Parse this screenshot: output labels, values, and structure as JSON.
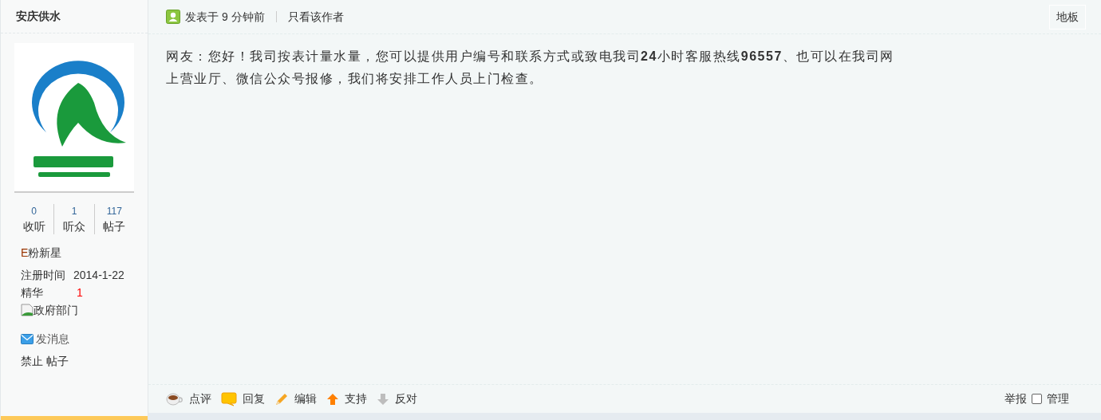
{
  "author": {
    "name": "安庆供水",
    "avatar": {
      "kind": "picture"
    },
    "stats": [
      {
        "value": "0",
        "label": "收听"
      },
      {
        "value": "1",
        "label": "听众"
      },
      {
        "value": "117",
        "label": "帖子"
      }
    ],
    "rank": {
      "prefix": "E",
      "rest": "粉新星"
    },
    "fields": [
      {
        "label": "注册时间",
        "value": "2014-1-22",
        "kind": "date"
      },
      {
        "label": "精华",
        "value": "1",
        "kind": "count"
      }
    ],
    "group_image_alt": "政府部门",
    "message_link": "发消息",
    "admin_links": [
      "禁止",
      "帖子"
    ]
  },
  "post": {
    "posted": "发表于 9 分钟前",
    "author_only": "只看该作者",
    "floor": "地板",
    "body": "网友：您好！我司按表计量水量，您可以提供用户编号和联系方式或致电我司**24**小时客服热线**96557**、也可以在我司网上营业厅、微信公众号报修，我们将安排工作人员上门检查。",
    "actions": [
      {
        "kind": "comment",
        "label": "点评"
      },
      {
        "kind": "reply",
        "label": "回复"
      },
      {
        "kind": "edit",
        "label": "编辑"
      },
      {
        "kind": "support",
        "label": "支持"
      },
      {
        "kind": "oppose",
        "label": "反对"
      }
    ],
    "report": "举报",
    "manage": {
      "label": "管理",
      "checked": false
    }
  }
}
